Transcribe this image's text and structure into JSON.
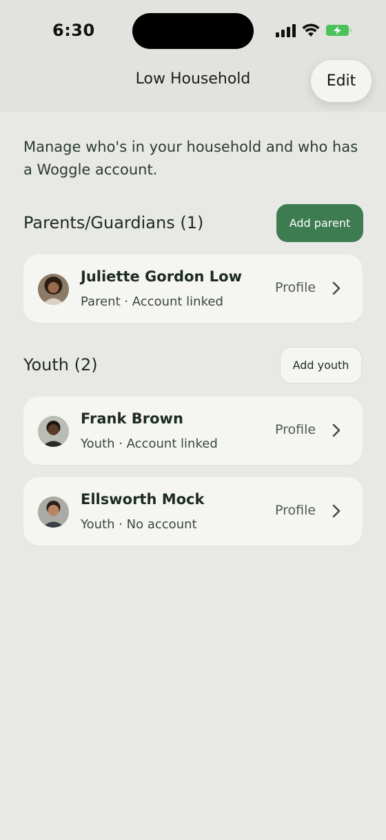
{
  "status_bar": {
    "time": "6:30",
    "icons": [
      "signal-icon",
      "wifi-icon",
      "battery-charging-icon"
    ],
    "battery_color": "#4cc25a"
  },
  "header": {
    "title": "Low Household",
    "edit_label": "Edit"
  },
  "intro_text": "Manage who's in your household and who has a Woggle account.",
  "parents": {
    "title": "Parents/Guardians (1)",
    "add_label": "Add parent",
    "members": [
      {
        "name": "Juliette Gordon Low",
        "subtitle": "Parent · Account linked",
        "profile_label": "Profile"
      }
    ]
  },
  "youth": {
    "title": "Youth (2)",
    "add_label": "Add youth",
    "members": [
      {
        "name": "Frank Brown",
        "subtitle": "Youth · Account linked",
        "profile_label": "Profile"
      },
      {
        "name": "Ellsworth Mock",
        "subtitle": "Youth · No account",
        "profile_label": "Profile"
      }
    ]
  },
  "colors": {
    "background": "#e8e9e4",
    "card": "#f5f5f1",
    "accent_green": "#3d7b50"
  }
}
